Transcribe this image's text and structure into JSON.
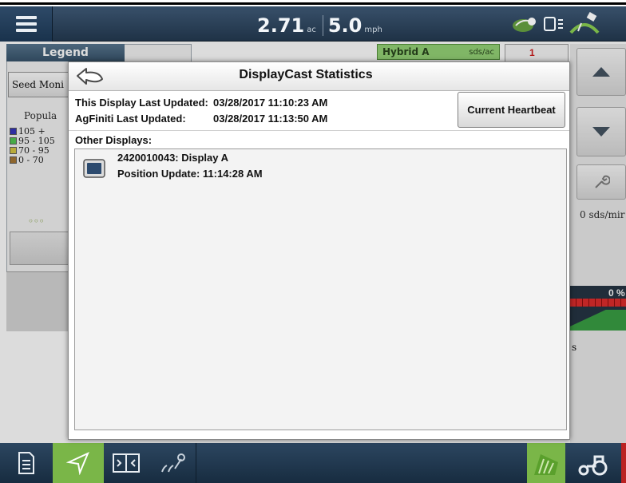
{
  "topbar": {
    "area_value": "2.71",
    "area_unit": "ac",
    "speed_value": "5.0",
    "speed_unit": "mph"
  },
  "status_icons": [
    "gps-icon",
    "display-sync-icon",
    "satellite-icon"
  ],
  "legend": {
    "header": "Legend",
    "seed_monitor_button": "Seed Moni",
    "population_label": "Popula",
    "ranges": [
      {
        "label": "105 +",
        "color": "#2b2bb8"
      },
      {
        "label": "95 - 105",
        "color": "#49c24a"
      },
      {
        "label": "70 - 95",
        "color": "#d4c23a"
      },
      {
        "label": "0 - 70",
        "color": "#a0702a"
      }
    ]
  },
  "product_tab": {
    "name": "Hybrid A",
    "rate_unit": "sds/ac"
  },
  "row_tab": {
    "label": "1"
  },
  "right_panel": {
    "rate_text": "0 sds/mir",
    "percent_text": "0 %",
    "s_text": "s"
  },
  "modal": {
    "title": "DisplayCast Statistics",
    "this_display_label": "This Display Last Updated:",
    "this_display_value": "03/28/2017 11:10:23 AM",
    "agfiniti_label": "AgFiniti Last Updated:",
    "agfiniti_value": "03/28/2017 11:13:50 AM",
    "heartbeat_button": "Current Heartbeat",
    "other_displays_label": "Other Displays:",
    "displays": [
      {
        "name": "2420010043: Display A",
        "position_update": "Position Update: 11:14:28 AM"
      }
    ]
  },
  "toolbar": {
    "items": [
      "document-icon",
      "navigation-icon",
      "split-view-icon",
      "planting-icon",
      "field-icon",
      "tractor-icon"
    ]
  },
  "colors": {
    "accent_green": "#7ab648",
    "topbar_blue": "#1f3246",
    "hybrid_green": "#8fd16f"
  }
}
